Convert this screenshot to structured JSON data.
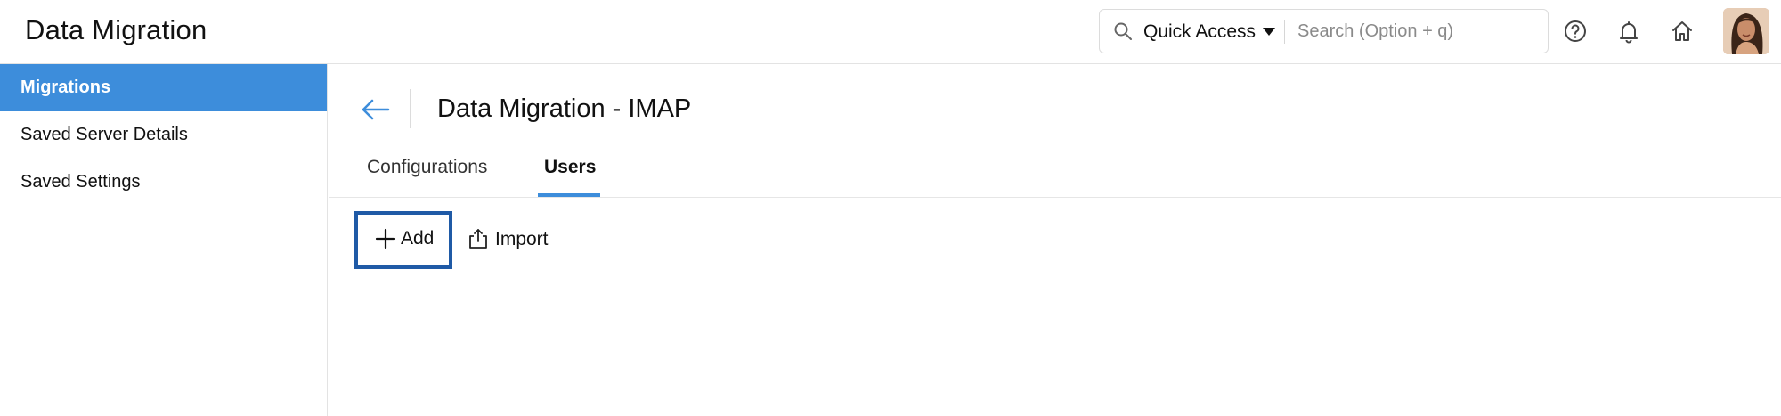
{
  "header": {
    "app_title": "Data Migration",
    "quick_access_label": "Quick Access",
    "search_placeholder": "Search (Option + q)",
    "icons": [
      "search-icon",
      "caret-down-icon",
      "help-icon",
      "bell-icon",
      "home-icon"
    ]
  },
  "sidebar": {
    "items": [
      {
        "label": "Migrations",
        "active": true
      },
      {
        "label": "Saved Server Details",
        "active": false
      },
      {
        "label": "Saved Settings",
        "active": false
      }
    ]
  },
  "main": {
    "title": "Data Migration - IMAP",
    "tabs": [
      {
        "label": "Configurations",
        "active": false
      },
      {
        "label": "Users",
        "active": true
      }
    ],
    "actions": {
      "add_label": "Add",
      "import_label": "Import"
    }
  },
  "colors": {
    "accent": "#3d8ddb",
    "focus_border": "#1f5aa6"
  }
}
